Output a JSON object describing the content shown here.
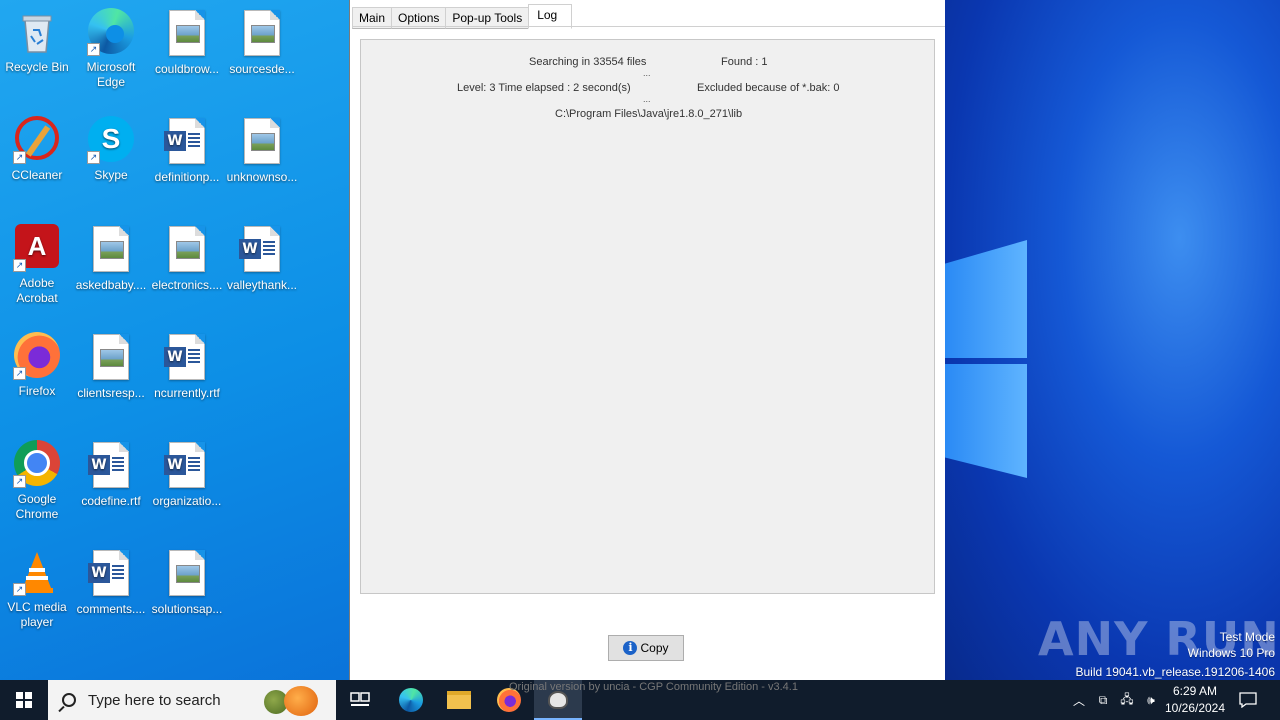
{
  "desktop": {
    "icons": [
      {
        "label": "Recycle Bin",
        "icon": "recycle-bin-icon"
      },
      {
        "label": "Microsoft Edge",
        "icon": "edge-icon"
      },
      {
        "label": "couldbrow...",
        "icon": "image-file-icon"
      },
      {
        "label": "sourcesde...",
        "icon": "image-file-icon"
      },
      {
        "label": "CCleaner",
        "icon": "ccleaner-icon"
      },
      {
        "label": "Skype",
        "icon": "skype-icon"
      },
      {
        "label": "definitionp...",
        "icon": "word-file-icon"
      },
      {
        "label": "unknownso...",
        "icon": "image-file-icon"
      },
      {
        "label": "Adobe Acrobat",
        "icon": "acrobat-icon"
      },
      {
        "label": "askedbaby....",
        "icon": "image-file-icon"
      },
      {
        "label": "electronics....",
        "icon": "image-file-icon"
      },
      {
        "label": "valleythank...",
        "icon": "word-file-icon"
      },
      {
        "label": "Firefox",
        "icon": "firefox-icon"
      },
      {
        "label": "clientsresp...",
        "icon": "image-file-icon"
      },
      {
        "label": "ncurrently.rtf",
        "icon": "word-file-icon"
      },
      {
        "label": "Google Chrome",
        "icon": "chrome-icon"
      },
      {
        "label": "codefine.rtf",
        "icon": "word-file-icon"
      },
      {
        "label": "organizatio...",
        "icon": "word-file-icon"
      },
      {
        "label": "VLC media player",
        "icon": "vlc-icon"
      },
      {
        "label": "comments....",
        "icon": "word-file-icon"
      },
      {
        "label": "solutionsap...",
        "icon": "image-file-icon"
      }
    ]
  },
  "app": {
    "tabs": [
      {
        "label": "Main",
        "active": false
      },
      {
        "label": "Options",
        "active": false
      },
      {
        "label": "Pop-up Tools",
        "active": false
      },
      {
        "label": "Log",
        "active": true
      }
    ],
    "log": {
      "searching": "Searching in 33554 files",
      "found": "Found : 1",
      "dots1": "...",
      "level": "Level: 3 Time elapsed : 2 second(s)",
      "excluded": "Excluded because of *.bak: 0",
      "dots2": "...",
      "path": "C:\\Program Files\\Java\\jre1.8.0_271\\lib"
    },
    "copy_label": "Copy",
    "status": "Original version by uncia - CGP Community Edition - v3.4.1"
  },
  "watermark": {
    "brand": "ANY RUN",
    "test_mode": "Test Mode",
    "edition": "Windows 10 Pro",
    "build": "Build 19041.vb_release.191206-1406"
  },
  "taskbar": {
    "search_placeholder": "Type here to search",
    "time": "6:29 AM",
    "date": "10/26/2024",
    "accent": "#78b4ff"
  }
}
